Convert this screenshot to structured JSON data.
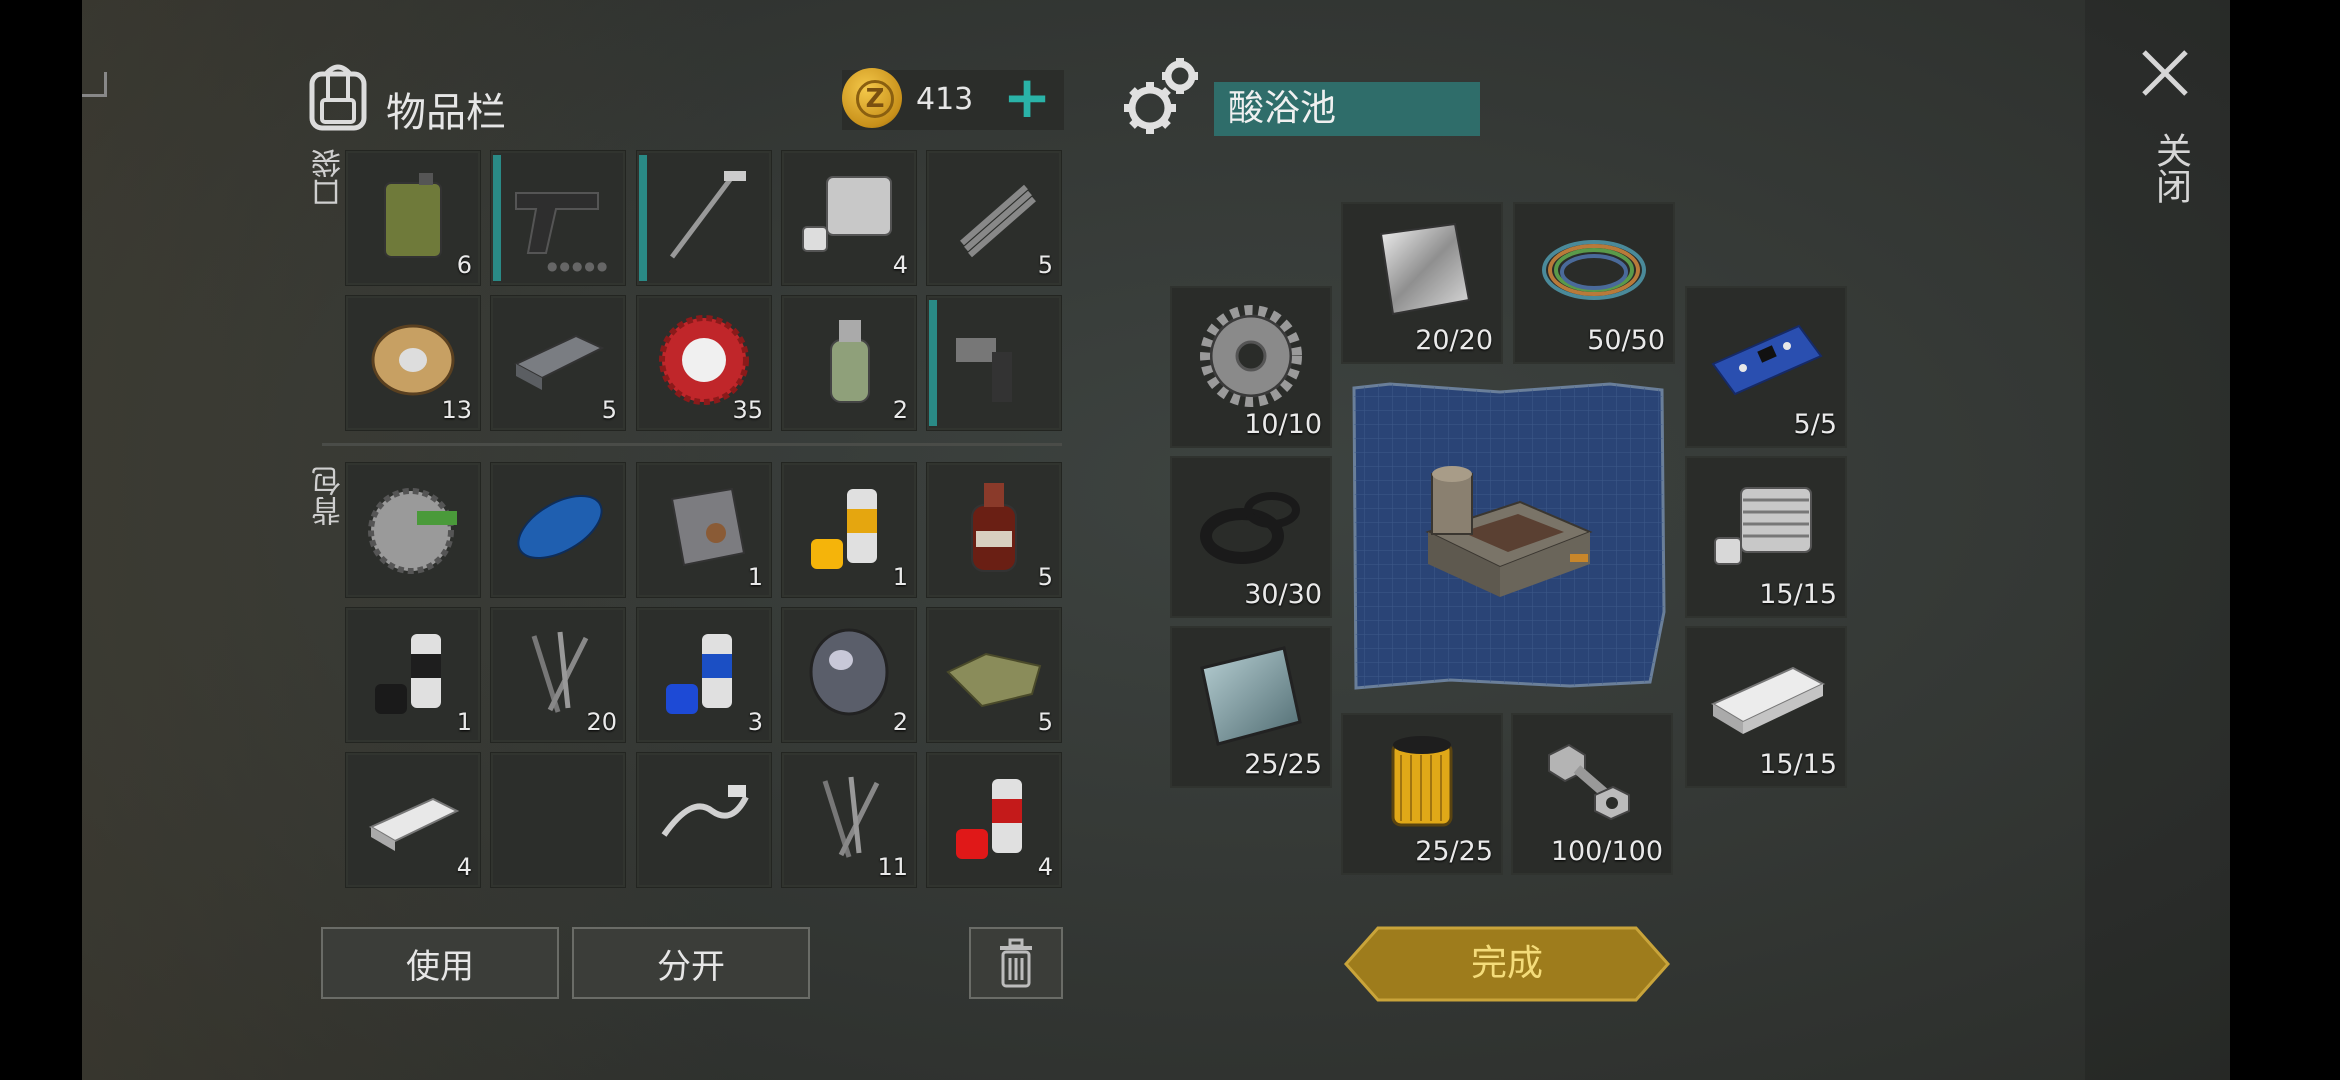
{
  "inventory": {
    "title": "物品栏",
    "coins": "413",
    "coin_symbol": "Z",
    "add_symbol": "+",
    "pocket_label": "口袋",
    "backpack_label": "背包",
    "pocket_slots": [
      {
        "icon": "fuel-canister-icon",
        "qty": "6"
      },
      {
        "icon": "pistol-icon",
        "qty": "",
        "weapon": true
      },
      {
        "icon": "golf-club-icon",
        "qty": "",
        "weapon": true
      },
      {
        "icon": "engine-cylinder-icon",
        "qty": "4"
      },
      {
        "icon": "spring-icon",
        "qty": "5"
      },
      {
        "icon": "wire-spool-icon",
        "qty": "13"
      },
      {
        "icon": "metal-ingot-icon",
        "qty": "5"
      },
      {
        "icon": "bottle-cap-icon",
        "qty": "35"
      },
      {
        "icon": "chemical-bottle-icon",
        "qty": "2"
      },
      {
        "icon": "tool-grinder-icon",
        "qty": "",
        "weapon": true
      }
    ],
    "backpack_slots": [
      {
        "icon": "saw-blade-icon",
        "qty": ""
      },
      {
        "icon": "blue-tank-icon",
        "qty": ""
      },
      {
        "icon": "rusty-plate-icon",
        "qty": "1"
      },
      {
        "icon": "yellow-spray-can-icon",
        "qty": "1"
      },
      {
        "icon": "spirit-bottle-icon",
        "qty": "5"
      },
      {
        "icon": "black-spray-can-icon",
        "qty": "1"
      },
      {
        "icon": "nails-icon",
        "qty": "20"
      },
      {
        "icon": "blue-spray-can-icon",
        "qty": "3"
      },
      {
        "icon": "lens-icon",
        "qty": "2"
      },
      {
        "icon": "cloth-icon",
        "qty": "5"
      },
      {
        "icon": "silver-bar-icon",
        "qty": "4"
      },
      {
        "icon": "empty",
        "qty": ""
      },
      {
        "icon": "handlebar-icon",
        "qty": ""
      },
      {
        "icon": "nails-icon",
        "qty": "11"
      },
      {
        "icon": "red-spray-can-icon",
        "qty": "4"
      }
    ],
    "use_label": "使用",
    "split_label": "分开",
    "trash_icon": "trash-icon"
  },
  "crafting": {
    "name": "酸浴池",
    "blueprint_icon": "acid-bath-icon",
    "ingredients": {
      "steel_plate": {
        "icon": "steel-plate-icon",
        "qty": "20/20"
      },
      "wires": {
        "icon": "wires-icon",
        "qty": "50/50"
      },
      "gear": {
        "icon": "gear-icon",
        "qty": "10/10"
      },
      "circuit": {
        "icon": "circuit-board-icon",
        "qty": "5/5"
      },
      "rubber_rings": {
        "icon": "rubber-rings-icon",
        "qty": "30/30"
      },
      "cylinder": {
        "icon": "engine-cylinder-icon",
        "qty": "15/15"
      },
      "glass_plate": {
        "icon": "glass-plate-icon",
        "qty": "25/25"
      },
      "aluminum_bar": {
        "icon": "aluminum-bar-icon",
        "qty": "15/15"
      },
      "filter": {
        "icon": "oil-filter-icon",
        "qty": "25/25"
      },
      "bolts": {
        "icon": "bolt-nut-icon",
        "qty": "100/100"
      }
    },
    "complete_label": "完成"
  },
  "close": {
    "label": "关闭",
    "icon": "close-icon"
  },
  "colors": {
    "accent": "#2f6d6a",
    "gold": "#a8841f",
    "weapon_bar": "#2a8a86"
  }
}
